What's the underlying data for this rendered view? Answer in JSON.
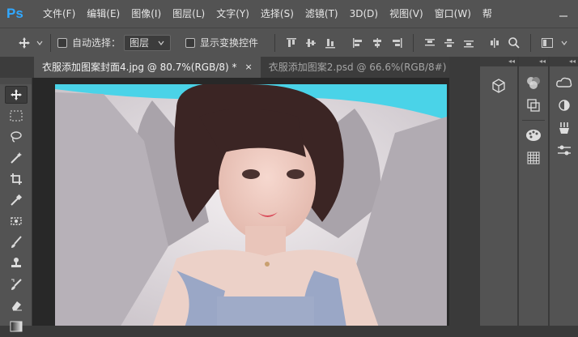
{
  "app": {
    "logo": "Ps"
  },
  "menu": [
    "文件(F)",
    "编辑(E)",
    "图像(I)",
    "图层(L)",
    "文字(Y)",
    "选择(S)",
    "滤镜(T)",
    "3D(D)",
    "视图(V)",
    "窗口(W)",
    "帮"
  ],
  "options": {
    "auto_select_label": "自动选择：",
    "auto_select_value": "图层",
    "show_transform_label": "显示变换控件"
  },
  "tabs": [
    {
      "label": "衣服添加图案封面4.jpg @ 80.7%(RGB/8) *",
      "close": "×"
    },
    {
      "label": "衣服添加图案2.psd @ 66.6%(RGB/8#)",
      "close": "×"
    }
  ],
  "colors": {
    "accent": "#31a8ff",
    "canvas_top_band": "#4ad3e8"
  },
  "icons": {
    "toolbar": [
      "move-icon",
      "marquee-icon",
      "lasso-icon",
      "magic-wand-icon",
      "crop-icon",
      "eyedropper-icon",
      "patch-icon",
      "brush-icon",
      "stamp-icon",
      "history-brush-icon",
      "eraser-icon",
      "gradient-icon"
    ],
    "panels": [
      "3d-icon",
      "color-icon",
      "adjustments-icon",
      "swatches-icon",
      "grid-icon",
      "libraries-icon",
      "contrast-icon",
      "paths-icon",
      "properties-icon"
    ]
  }
}
